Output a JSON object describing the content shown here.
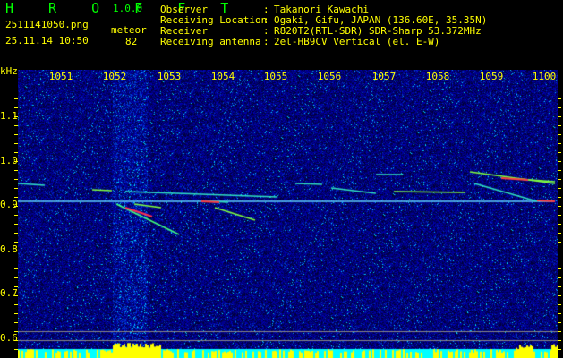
{
  "app": {
    "name": "H R O F F T",
    "version": "1.0.0"
  },
  "file": {
    "name": "2511141050.png",
    "datetime": "25.11.14 10:50"
  },
  "meteor": {
    "label": "meteor",
    "count": "82"
  },
  "info": [
    {
      "label": "Observer",
      "sep": ":",
      "value": "Takanori Kawachi"
    },
    {
      "label": "Receiving Location",
      "sep": ":",
      "value": "Ogaki, Gifu, JAPAN (136.60E, 35.35N)"
    },
    {
      "label": "Receiver",
      "sep": ":",
      "value": "R820T2(RTL-SDR) SDR-Sharp 53.372MHz"
    },
    {
      "label": "Receiving antenna",
      "sep": ":",
      "value": "2el-HB9CV Vertical (el. E-W)"
    }
  ],
  "axis": {
    "y_unit": "kHz",
    "x_ticks": [
      "1051",
      "1052",
      "1053",
      "1054",
      "1055",
      "1056",
      "1057",
      "1058",
      "1059",
      "1100"
    ],
    "y_ticks": [
      "1.1",
      "1.0",
      "0.9",
      "0.8",
      "0.7",
      "0.6"
    ]
  },
  "colors": {
    "text": "#ffff00",
    "title": "#00ff00",
    "level_base": "#00ffff",
    "level_bar": "#ffff00"
  }
}
